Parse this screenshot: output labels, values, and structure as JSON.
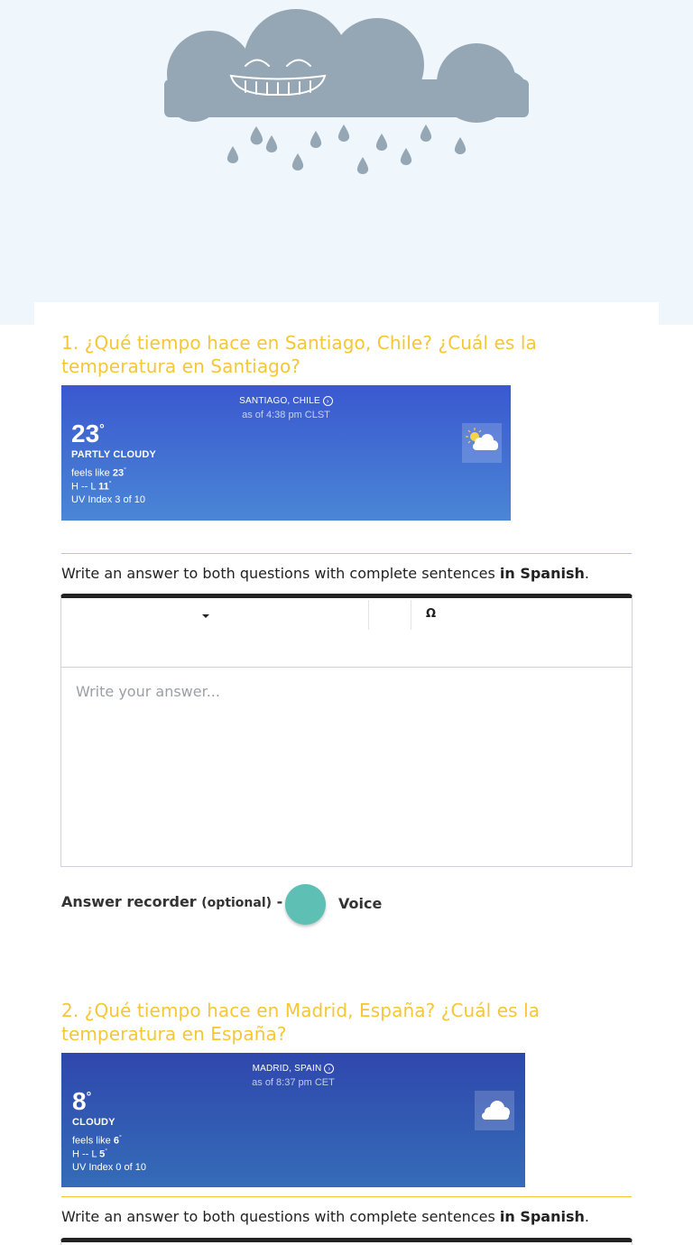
{
  "header": {
    "illustration": "smiling-rain-cloud",
    "cloud_color": "#95a7b5"
  },
  "questions": [
    {
      "title": "1. ¿Qué tiempo hace en Santiago, Chile? ¿Cuál es la temperatura en Santiago?",
      "weather": {
        "location": "SANTIAGO, CHILE",
        "as_of": "as of 4:38 pm CLST",
        "temp": "23",
        "degree": "°",
        "condition": "PARTLY CLOUDY",
        "feels_like_label": "feels like",
        "feels_like": "23",
        "hl_label": "H -- L",
        "low": "11",
        "uv": "UV Index 3 of 10",
        "icon": "partly-cloudy-icon"
      },
      "instruction": "Write an answer to both questions with complete sentences",
      "instruction_bold": "in Spanish",
      "instruction_end": ".",
      "answer_placeholder": "Write your answer...",
      "recorder_label": "Answer recorder",
      "recorder_optional": "(optional)",
      "recorder_dash": "-",
      "voice_label": "Voice",
      "toolbar_symbol": "Ω"
    },
    {
      "title": "2. ¿Qué tiempo hace en Madrid, España? ¿Cuál es la temperatura en España?",
      "weather": {
        "location": "MADRID, SPAIN",
        "as_of": "as of 8:37 pm CET",
        "temp": "8",
        "degree": "°",
        "condition": "CLOUDY",
        "feels_like_label": "feels like",
        "feels_like": "6",
        "hl_label": "H -- L",
        "low": "5",
        "uv": "UV Index 0 of 10",
        "icon": "cloudy-icon"
      },
      "instruction": "Write an answer to both questions with complete sentences",
      "instruction_bold": "in Spanish",
      "instruction_end": "."
    }
  ],
  "colors": {
    "title": "#f5c636",
    "record_button": "#5ebfb5",
    "card_bg": "#ffffff",
    "hero_bg": "#eff6fc"
  }
}
